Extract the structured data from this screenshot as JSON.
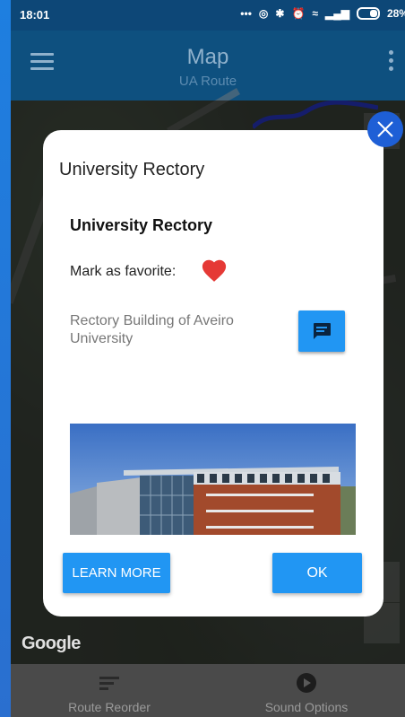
{
  "status_bar": {
    "time": "18:01",
    "battery_percent": "28%"
  },
  "app_bar": {
    "title": "Map",
    "subtitle": "UA Route"
  },
  "map": {
    "attribution": "Google"
  },
  "dialog": {
    "title": "University Rectory",
    "poi_name": "University Rectory",
    "favorite_label": "Mark as favorite:",
    "description": "Rectory Building of Aveiro University",
    "learn_more_label": "LEARN MORE",
    "ok_label": "OK"
  },
  "bottom_nav": {
    "items": [
      {
        "label": "Route Reorder",
        "icon": "reorder-icon"
      },
      {
        "label": "Sound Options",
        "icon": "play-circle-icon"
      }
    ]
  },
  "colors": {
    "primary": "#0e507f",
    "accent": "#2196f3",
    "heart": "#e53935",
    "close_button": "#1e5fd6"
  }
}
